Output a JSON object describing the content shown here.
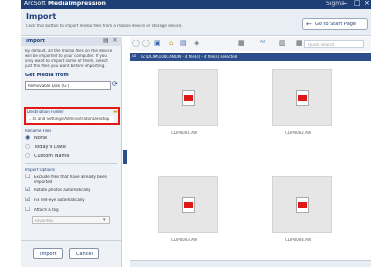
{
  "app": {
    "brand": "ArcSoft",
    "name": "MediaImpression",
    "user": "Sigma"
  },
  "header": {
    "title": "Import",
    "subtitle": "Click this button to import media files from a mobile device or storage device.",
    "start_page_button": "Go to Start Page"
  },
  "sidebar": {
    "title": "Import",
    "description": [
      "By default, all the media files on the device",
      "will be imported to your computer. If you",
      "only want to import some of them, select",
      "just the files you want before importing."
    ],
    "get_media_from_label": "Get Media from",
    "source_value": "Removable Disk (G:)",
    "destination_label": "Destination Folder",
    "destination_value": "...ts and Settings\\Administrator\\Desktop",
    "rename_label": "Rename Files",
    "rename_options": [
      "None",
      "Today's Date",
      "Custom Name"
    ],
    "rename_selected": 0,
    "import_options_label": "Import Options",
    "import_options": [
      {
        "label": "Exclude files that have already been",
        "label2": "imported",
        "checked": false
      },
      {
        "label": "Rotate photos automatically",
        "checked": true
      },
      {
        "label": "Fix red-eye automatically",
        "checked": true
      },
      {
        "label": "Attach a tag",
        "checked": false
      }
    ],
    "tag_placeholder": "Favorites",
    "import_button": "Import",
    "cancel_button": "Cancel"
  },
  "search": {
    "placeholder": "Quick Search"
  },
  "content": {
    "path": "G:\\DCIM\\100CANON - 4 file(s) - 4 file(s) selected",
    "files": [
      {
        "name": "CLIP0001.AVI"
      },
      {
        "name": "CLIP0002.AVI"
      },
      {
        "name": "CLIP0003.AVI"
      },
      {
        "name": "CLIP0004.AVI"
      }
    ]
  },
  "colors": {
    "titlebar": "#1e3f76",
    "accent": "#2c4f8c",
    "highlight": "#e01818",
    "tile": "#e6e6e6"
  }
}
